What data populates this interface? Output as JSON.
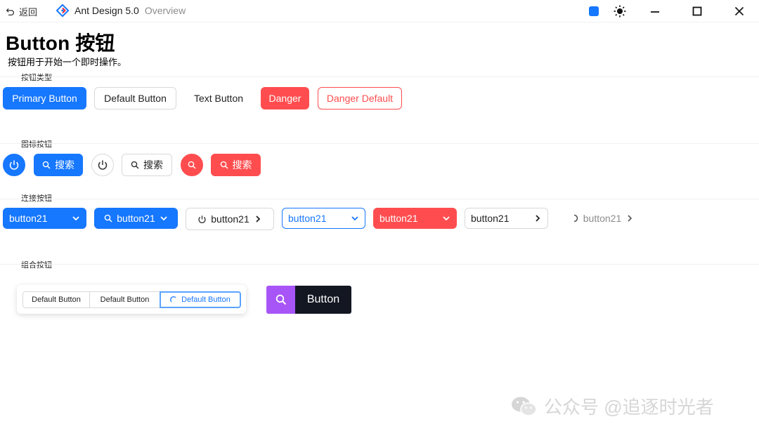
{
  "titlebar": {
    "back_label": "返回",
    "app_name": "Ant Design 5.0",
    "app_sub": "Overview",
    "accent_color": "#1677ff",
    "icons": [
      "undo-icon",
      "antd-logo-icon",
      "color-theme-icon",
      "sun-icon",
      "minimize-icon",
      "maximize-icon",
      "close-icon"
    ]
  },
  "page": {
    "title": "Button 按钮",
    "description": "按钮用于开始一个即时操作。"
  },
  "sections": {
    "types": {
      "label": "按钮类型",
      "primary": "Primary Button",
      "default": "Default Button",
      "text": "Text Button",
      "danger": "Danger",
      "danger_default": "Danger Default"
    },
    "icon": {
      "label": "图标按钮",
      "search": "搜索"
    },
    "link": {
      "label": "连接按钮",
      "button": "button21"
    },
    "group": {
      "label": "组合按钮",
      "segments": [
        "Default Button",
        "Default Button",
        "Default Button"
      ],
      "dark_button": "Button"
    }
  },
  "colors": {
    "primary": "#1677ff",
    "danger": "#ff4d4f",
    "purple": "#a855f7",
    "dark": "#131722"
  },
  "watermark": {
    "text": "公众号 @追逐时光者"
  }
}
